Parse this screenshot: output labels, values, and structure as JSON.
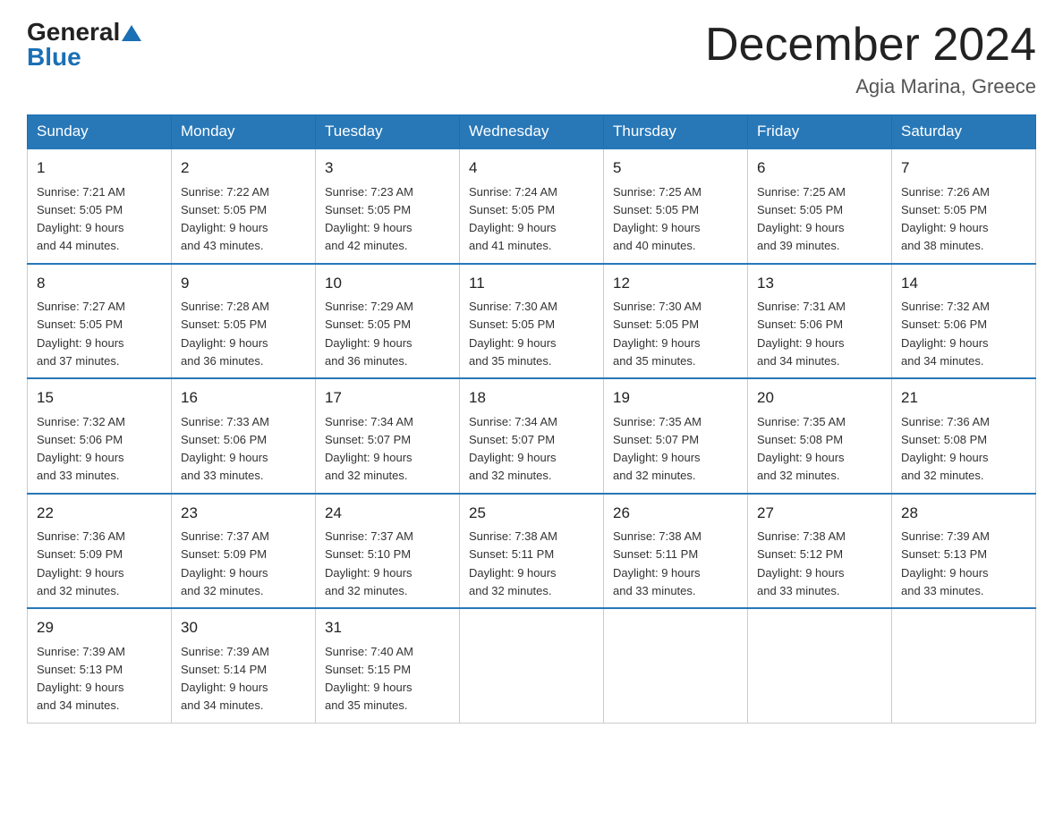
{
  "header": {
    "logo_general": "General",
    "logo_blue": "Blue",
    "month_title": "December 2024",
    "location": "Agia Marina, Greece"
  },
  "days_of_week": [
    "Sunday",
    "Monday",
    "Tuesday",
    "Wednesday",
    "Thursday",
    "Friday",
    "Saturday"
  ],
  "weeks": [
    [
      {
        "day": "1",
        "sunrise": "7:21 AM",
        "sunset": "5:05 PM",
        "daylight": "9 hours and 44 minutes."
      },
      {
        "day": "2",
        "sunrise": "7:22 AM",
        "sunset": "5:05 PM",
        "daylight": "9 hours and 43 minutes."
      },
      {
        "day": "3",
        "sunrise": "7:23 AM",
        "sunset": "5:05 PM",
        "daylight": "9 hours and 42 minutes."
      },
      {
        "day": "4",
        "sunrise": "7:24 AM",
        "sunset": "5:05 PM",
        "daylight": "9 hours and 41 minutes."
      },
      {
        "day": "5",
        "sunrise": "7:25 AM",
        "sunset": "5:05 PM",
        "daylight": "9 hours and 40 minutes."
      },
      {
        "day": "6",
        "sunrise": "7:25 AM",
        "sunset": "5:05 PM",
        "daylight": "9 hours and 39 minutes."
      },
      {
        "day": "7",
        "sunrise": "7:26 AM",
        "sunset": "5:05 PM",
        "daylight": "9 hours and 38 minutes."
      }
    ],
    [
      {
        "day": "8",
        "sunrise": "7:27 AM",
        "sunset": "5:05 PM",
        "daylight": "9 hours and 37 minutes."
      },
      {
        "day": "9",
        "sunrise": "7:28 AM",
        "sunset": "5:05 PM",
        "daylight": "9 hours and 36 minutes."
      },
      {
        "day": "10",
        "sunrise": "7:29 AM",
        "sunset": "5:05 PM",
        "daylight": "9 hours and 36 minutes."
      },
      {
        "day": "11",
        "sunrise": "7:30 AM",
        "sunset": "5:05 PM",
        "daylight": "9 hours and 35 minutes."
      },
      {
        "day": "12",
        "sunrise": "7:30 AM",
        "sunset": "5:05 PM",
        "daylight": "9 hours and 35 minutes."
      },
      {
        "day": "13",
        "sunrise": "7:31 AM",
        "sunset": "5:06 PM",
        "daylight": "9 hours and 34 minutes."
      },
      {
        "day": "14",
        "sunrise": "7:32 AM",
        "sunset": "5:06 PM",
        "daylight": "9 hours and 34 minutes."
      }
    ],
    [
      {
        "day": "15",
        "sunrise": "7:32 AM",
        "sunset": "5:06 PM",
        "daylight": "9 hours and 33 minutes."
      },
      {
        "day": "16",
        "sunrise": "7:33 AM",
        "sunset": "5:06 PM",
        "daylight": "9 hours and 33 minutes."
      },
      {
        "day": "17",
        "sunrise": "7:34 AM",
        "sunset": "5:07 PM",
        "daylight": "9 hours and 32 minutes."
      },
      {
        "day": "18",
        "sunrise": "7:34 AM",
        "sunset": "5:07 PM",
        "daylight": "9 hours and 32 minutes."
      },
      {
        "day": "19",
        "sunrise": "7:35 AM",
        "sunset": "5:07 PM",
        "daylight": "9 hours and 32 minutes."
      },
      {
        "day": "20",
        "sunrise": "7:35 AM",
        "sunset": "5:08 PM",
        "daylight": "9 hours and 32 minutes."
      },
      {
        "day": "21",
        "sunrise": "7:36 AM",
        "sunset": "5:08 PM",
        "daylight": "9 hours and 32 minutes."
      }
    ],
    [
      {
        "day": "22",
        "sunrise": "7:36 AM",
        "sunset": "5:09 PM",
        "daylight": "9 hours and 32 minutes."
      },
      {
        "day": "23",
        "sunrise": "7:37 AM",
        "sunset": "5:09 PM",
        "daylight": "9 hours and 32 minutes."
      },
      {
        "day": "24",
        "sunrise": "7:37 AM",
        "sunset": "5:10 PM",
        "daylight": "9 hours and 32 minutes."
      },
      {
        "day": "25",
        "sunrise": "7:38 AM",
        "sunset": "5:11 PM",
        "daylight": "9 hours and 32 minutes."
      },
      {
        "day": "26",
        "sunrise": "7:38 AM",
        "sunset": "5:11 PM",
        "daylight": "9 hours and 33 minutes."
      },
      {
        "day": "27",
        "sunrise": "7:38 AM",
        "sunset": "5:12 PM",
        "daylight": "9 hours and 33 minutes."
      },
      {
        "day": "28",
        "sunrise": "7:39 AM",
        "sunset": "5:13 PM",
        "daylight": "9 hours and 33 minutes."
      }
    ],
    [
      {
        "day": "29",
        "sunrise": "7:39 AM",
        "sunset": "5:13 PM",
        "daylight": "9 hours and 34 minutes."
      },
      {
        "day": "30",
        "sunrise": "7:39 AM",
        "sunset": "5:14 PM",
        "daylight": "9 hours and 34 minutes."
      },
      {
        "day": "31",
        "sunrise": "7:40 AM",
        "sunset": "5:15 PM",
        "daylight": "9 hours and 35 minutes."
      },
      null,
      null,
      null,
      null
    ]
  ],
  "labels": {
    "sunrise": "Sunrise:",
    "sunset": "Sunset:",
    "daylight": "Daylight:"
  }
}
